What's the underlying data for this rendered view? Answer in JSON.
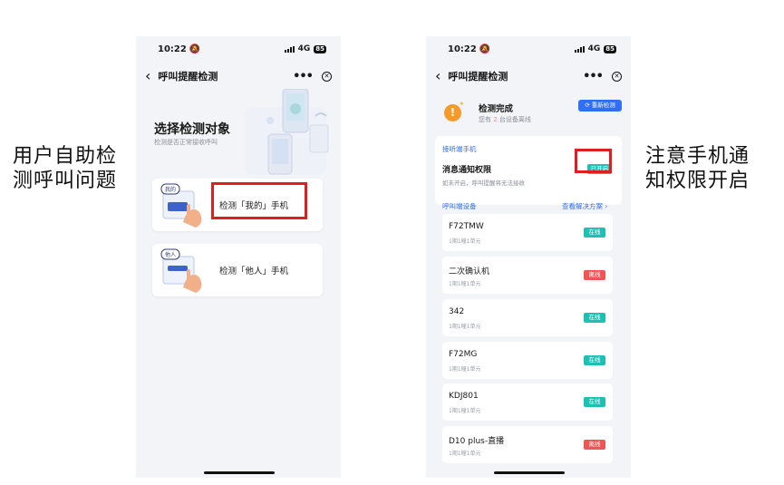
{
  "captions": {
    "left": "用户自助检测呼叫问题",
    "right": "注意手机通知权限开启"
  },
  "status_bar": {
    "time": "10:22",
    "network": "4G",
    "battery": "85"
  },
  "nav": {
    "title": "呼叫提醒检测",
    "more_icon": "more-dots-icon",
    "close_icon": "close-circle-icon",
    "back_icon": "chevron-left-icon"
  },
  "select_screen": {
    "title": "选择检测对象",
    "subtitle": "检测是否正常接收呼叫",
    "options": [
      {
        "tag": "我的",
        "label": "检测「我的」手机"
      },
      {
        "tag": "他人",
        "label": "检测「他人」手机"
      }
    ]
  },
  "result_screen": {
    "summary_title": "检测完成",
    "summary_prefix": "您有",
    "summary_count": "2",
    "summary_suffix": "台设备离线",
    "redetect_label": "⟳ 重新检测",
    "answer_section_label": "接听端手机",
    "permission_title": "消息通知权限",
    "permission_sub": "如未开启，呼叫提醒将无法接收",
    "permission_status": "已开启",
    "ring_section_label": "呼叫端设备",
    "solution_link": "查看解决方案 ›",
    "devices": [
      {
        "name": "F72TMW",
        "location": "1期1幢1单元",
        "status": "在线",
        "online": true
      },
      {
        "name": "二次确认机",
        "location": "1期1幢1单元",
        "status": "离线",
        "online": false
      },
      {
        "name": "342",
        "location": "1期1幢1单元",
        "status": "在线",
        "online": true
      },
      {
        "name": "F72MG",
        "location": "1期1幢1单元",
        "status": "在线",
        "online": true
      },
      {
        "name": "KDJ801",
        "location": "1期1幢1单元",
        "status": "在线",
        "online": true
      },
      {
        "name": "D10 plus-直播",
        "location": "1期1幢1单元",
        "status": "离线",
        "online": false
      }
    ]
  },
  "colors": {
    "accent_blue": "#2f6ef5",
    "online_teal": "#1fc0b4",
    "offline_red": "#f05454",
    "warning_orange": "#f39a2a",
    "highlight_red": "#e01e1e"
  }
}
